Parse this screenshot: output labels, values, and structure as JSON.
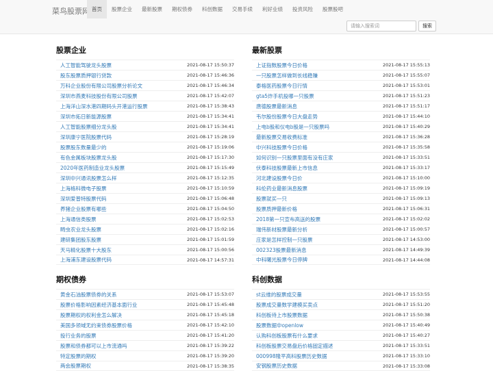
{
  "header": {
    "brand": "菜鸟股票网",
    "nav": [
      "首页",
      "股票企业",
      "最新股票",
      "期权债券",
      "科创数据",
      "交易手续",
      "利好业绩",
      "投资风险",
      "股票股吧"
    ],
    "search_placeholder": "请输入搜索词",
    "search_button": "搜索"
  },
  "sections": [
    {
      "title": "股票企业",
      "items": [
        {
          "title": "人工智能驾驶龙头股票",
          "time": "2021-08-17 15:50:37"
        },
        {
          "title": "股东股票质押银行贷款",
          "time": "2021-08-17 15:46:36"
        },
        {
          "title": "万科企业股份有限公司股票分析论文",
          "time": "2021-08-17 15:46:34"
        },
        {
          "title": "深圳市燕麦科技股份有限公司股票",
          "time": "2021-08-17 15:42:07"
        },
        {
          "title": "上海洋山深水港四期码头开港运行股票",
          "time": "2021-08-17 15:38:43"
        },
        {
          "title": "深圳市拓日新能源股票",
          "time": "2021-08-17 15:34:41"
        },
        {
          "title": "人工智能股票细分龙头股",
          "time": "2021-08-17 15:34:41"
        },
        {
          "title": "深圳康宁医院股票代码",
          "time": "2021-08-17 15:28:19"
        },
        {
          "title": "股票股东数量最少的",
          "time": "2021-08-17 15:19:06"
        },
        {
          "title": "有色金属板块股票龙头股",
          "time": "2021-08-17 15:17:30"
        },
        {
          "title": "2020年医药制造业龙头股票",
          "time": "2021-08-17 15:15:49"
        },
        {
          "title": "深圳中兴通讯股票怎么样",
          "time": "2021-08-17 15:12:35"
        },
        {
          "title": "上海格科微电子股票",
          "time": "2021-08-17 15:10:59"
        },
        {
          "title": "深圳爱普特股票代码",
          "time": "2021-08-17 15:06:48"
        },
        {
          "title": "养猪企业股票有哪些",
          "time": "2021-08-17 15:04:50"
        },
        {
          "title": "上海通信类股票",
          "time": "2021-08-17 15:02:53"
        },
        {
          "title": "畸虫农业龙头股票",
          "time": "2021-08-17 15:02:16"
        },
        {
          "title": "建研集团股东股票",
          "time": "2021-08-17 15:01:59"
        },
        {
          "title": "天马精化股票十大股东",
          "time": "2021-08-17 15:00:56"
        },
        {
          "title": "上海浦东建设股票代码",
          "time": "2021-08-17 14:57:31"
        }
      ]
    },
    {
      "title": "最新股票",
      "items": [
        {
          "title": "上证指数股票今日价格",
          "time": "2021-08-17 15:55:13"
        },
        {
          "title": "一只股票怎样做到长线稳赚",
          "time": "2021-08-17 15:55:07"
        },
        {
          "title": "泰格医药股票今日行情",
          "time": "2021-08-17 15:53:01"
        },
        {
          "title": "gta5炸手机投哪一只股票",
          "time": "2021-08-17 15:51:23"
        },
        {
          "title": "唐德股票最新消息",
          "time": "2021-08-17 15:51:17"
        },
        {
          "title": "韦尔股份股票今日大盘走势",
          "time": "2021-08-17 15:44:10"
        },
        {
          "title": "上电b股和仪电b股是一只股票吗",
          "time": "2021-08-17 15:40:29"
        },
        {
          "title": "最新股票交易收费标准",
          "time": "2021-08-17 15:36:28"
        },
        {
          "title": "中兴科技股票今日价格",
          "time": "2021-08-17 15:35:58"
        },
        {
          "title": "如何识别一只股票里面有没有庄家",
          "time": "2021-08-17 15:33:51"
        },
        {
          "title": "伏泰科技股票最新上市信息",
          "time": "2021-08-17 15:33:17"
        },
        {
          "title": "河北建设股票今日价",
          "time": "2021-08-17 15:10:00"
        },
        {
          "title": "科伦药业最新消息股票",
          "time": "2021-08-17 15:09:19"
        },
        {
          "title": "股票就买一只",
          "time": "2021-08-17 15:09:13"
        },
        {
          "title": "股票质押最新价格",
          "time": "2021-08-17 15:06:31"
        },
        {
          "title": "2018第一只宣布高送的股票",
          "time": "2021-08-17 15:02:02"
        },
        {
          "title": "瑞伟新材股票最新分析",
          "time": "2021-08-17 15:00:57"
        },
        {
          "title": "庄家是怎样控制一只股票",
          "time": "2021-08-17 14:53:00"
        },
        {
          "title": "002323股票最新消息",
          "time": "2021-08-17 14:49:39"
        },
        {
          "title": "中科曙光股票今日停牌",
          "time": "2021-08-17 14:44:08"
        }
      ]
    },
    {
      "title": "期权债券",
      "items": [
        {
          "title": "黄金石油股票债券的关系",
          "time": "2021-08-17 15:53:07"
        },
        {
          "title": "股票价格影响因素经济基本面行业",
          "time": "2021-08-17 15:45:48"
        },
        {
          "title": "股票期权的权利金怎么解决",
          "time": "2021-08-17 15:45:18"
        },
        {
          "title": "美国多领域无约束债券股票价格",
          "time": "2021-08-17 15:42:10"
        },
        {
          "title": "投行业务的股票",
          "time": "2021-08-17 15:41:20"
        },
        {
          "title": "股票和债券都可以上市流通吗",
          "time": "2021-08-17 15:39:22"
        },
        {
          "title": "特定股票的期权",
          "time": "2021-08-17 15:39:20"
        },
        {
          "title": "两会股票期权",
          "time": "2021-08-17 15:38:35"
        }
      ]
    },
    {
      "title": "科创数据",
      "items": [
        {
          "title": "st云维的股票成交量",
          "time": "2021-08-17 15:53:55"
        },
        {
          "title": "股票成交量数学建模买卖点",
          "time": "2021-08-17 15:51:20"
        },
        {
          "title": "科创板待上市股票数据",
          "time": "2021-08-17 15:50:38"
        },
        {
          "title": "股票数据中openlow",
          "time": "2021-08-17 15:40:49"
        },
        {
          "title": "认购科创板股票有什么要求",
          "time": "2021-08-17 15:40:27"
        },
        {
          "title": "科创板股票交易盘后价格固定描述",
          "time": "2021-08-17 15:33:51"
        },
        {
          "title": "000998隆平高科股票历史数据",
          "time": "2021-08-17 15:33:10"
        },
        {
          "title": "安钢股票历史数据",
          "time": "2021-08-17 15:33:08"
        }
      ]
    }
  ]
}
